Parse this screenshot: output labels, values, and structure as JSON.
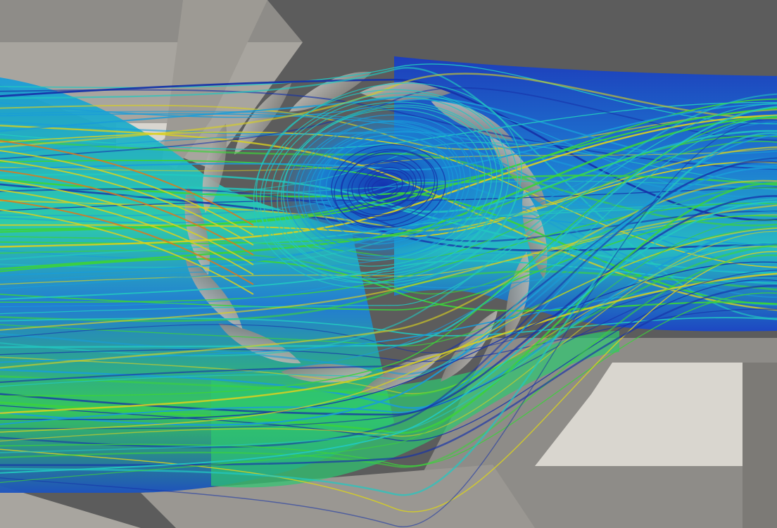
{
  "scene": {
    "subject": "streamline-visualization",
    "colors": {
      "background_dark": "#5c5c5c",
      "housing_mid": "#8e8c88",
      "housing_light": "#b3b0aa",
      "housing_pale": "#d9d6cf",
      "blade": "#9a9893",
      "flow_low": "#1632a8",
      "flow_mid_low": "#1a9cd8",
      "flow_mid": "#22c8c0",
      "flow_mid_high": "#3cd23a",
      "flow_high": "#d8d020",
      "flow_peak": "#e07818"
    },
    "icons": [
      "turbine-blade-icon",
      "vortex-icon"
    ]
  }
}
